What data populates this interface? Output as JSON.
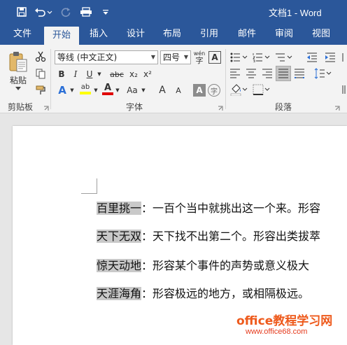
{
  "window": {
    "title": "文档1 - Word"
  },
  "tabs": [
    {
      "label": "文件"
    },
    {
      "label": "开始"
    },
    {
      "label": "插入"
    },
    {
      "label": "设计"
    },
    {
      "label": "布局"
    },
    {
      "label": "引用"
    },
    {
      "label": "邮件"
    },
    {
      "label": "审阅"
    },
    {
      "label": "视图"
    }
  ],
  "ribbon": {
    "clipboard": {
      "label": "剪贴板",
      "paste_label": "粘贴"
    },
    "font": {
      "label": "字体",
      "font_name": "等线 (中文正文)",
      "font_size": "四号",
      "wen_label": "wén",
      "bold": "B",
      "italic": "I",
      "underline": "U",
      "strike": "abc",
      "subscript": "x₂",
      "superscript": "x²",
      "text_effects": "A",
      "highlight": "ab",
      "font_color": "A",
      "change_case": "Aa",
      "grow": "A",
      "shrink": "A",
      "char_shading": "A",
      "enclose": "字",
      "phonetic": "A"
    },
    "paragraph": {
      "label": "段落"
    }
  },
  "document": {
    "lines": [
      {
        "term": "百里挑一",
        "definition": "：一百个当中就挑出这一个来。形容"
      },
      {
        "term": "天下无双",
        "definition": "：天下找不出第二个。形容出类拔萃"
      },
      {
        "term": "惊天动地",
        "definition": "：形容某个事件的声势或意义极大"
      },
      {
        "term": "天涯海角",
        "definition": "：形容极远的地方，或相隔极远。"
      }
    ]
  },
  "watermark": {
    "line1": "office教程学习网",
    "line2": "www.office68.com"
  },
  "colors": {
    "brand": "#2b579a",
    "highlight": "#c9c9c9",
    "watermark": "#ee5a1c",
    "font_color_bar": "#e00000",
    "highlight_bar": "#ffff00"
  }
}
